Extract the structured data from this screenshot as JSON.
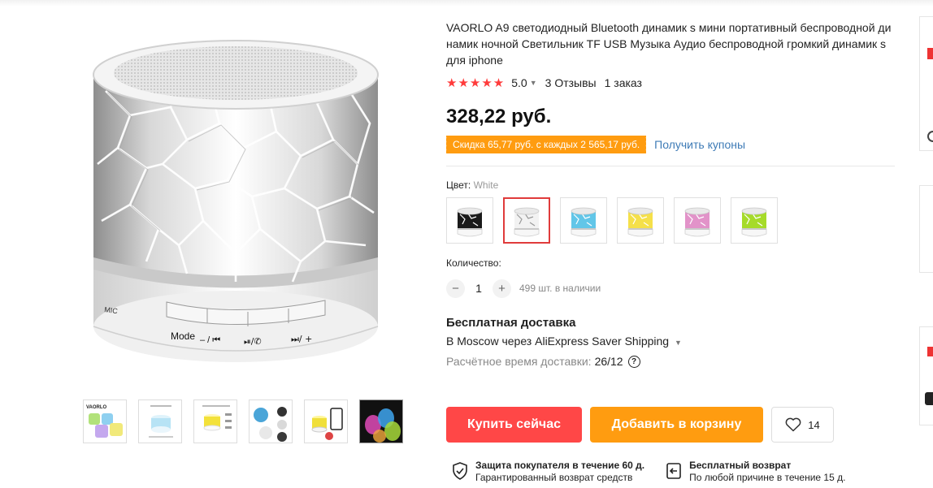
{
  "product": {
    "title": "VAORLO A9 светодиодный Bluetooth динамик s мини портативный беспроводной динамик ночной Светильник TF USB Музыка Аудио беспроводной громкий динамик s для iphone",
    "stars": "★★★★★",
    "rating": "5.0",
    "reviews": "3 Отзывы",
    "orders": "1 заказ",
    "price": "328,22 руб.",
    "coupon_text": "Скидка 65,77 руб. с каждых 2 565,17 руб.",
    "coupon_link": "Получить купоны"
  },
  "gallery": {
    "main_image": {
      "buttons_label_mode": "Mode",
      "buttons_label_minus": "– / ⏮",
      "buttons_label_play": "⏯/✆",
      "buttons_label_plus": "⏭/ +",
      "mic_label": "MIC"
    },
    "thumbnails": [
      "thumb-1",
      "thumb-2",
      "thumb-3",
      "thumb-4",
      "thumb-5",
      "thumb-6"
    ],
    "thumb1_brand": "VAORLO"
  },
  "color": {
    "label": "Цвет:",
    "value": "White",
    "options": [
      {
        "name": "black",
        "body": "#1a1a1a",
        "crack": "#ffffff"
      },
      {
        "name": "white",
        "body": "#f2f2f2",
        "crack": "#9a9a9a"
      },
      {
        "name": "blue",
        "body": "#62c6e8",
        "crack": "#ffffff"
      },
      {
        "name": "yellow",
        "body": "#f5e04a",
        "crack": "#ffffff"
      },
      {
        "name": "pink",
        "body": "#e293c9",
        "crack": "#ffffff"
      },
      {
        "name": "green",
        "body": "#a6db2a",
        "crack": "#ffffff"
      }
    ]
  },
  "quantity": {
    "label": "Количество:",
    "minus": "−",
    "value": "1",
    "plus": "+",
    "stock": "499 шт. в наличии"
  },
  "shipping": {
    "title": "Бесплатная доставка",
    "line": "В Moscow через AliExpress Saver Shipping",
    "time_label": "Расчётное время доставки:",
    "time_value": "26/12",
    "help": "?"
  },
  "actions": {
    "buy": "Купить сейчас",
    "cart": "Добавить в корзину",
    "wish_count": "14"
  },
  "guarantees": [
    {
      "title": "Защита покупателя в течение 60 д.",
      "sub": "Гарантированный возврат средств"
    },
    {
      "title": "Бесплатный возврат",
      "sub": "По любой причине в течение 15 д."
    }
  ],
  "colors": {
    "red": "#ff4747",
    "orange": "#ff9c10",
    "link": "#3e7bb6",
    "star": "#ff3b3b"
  }
}
